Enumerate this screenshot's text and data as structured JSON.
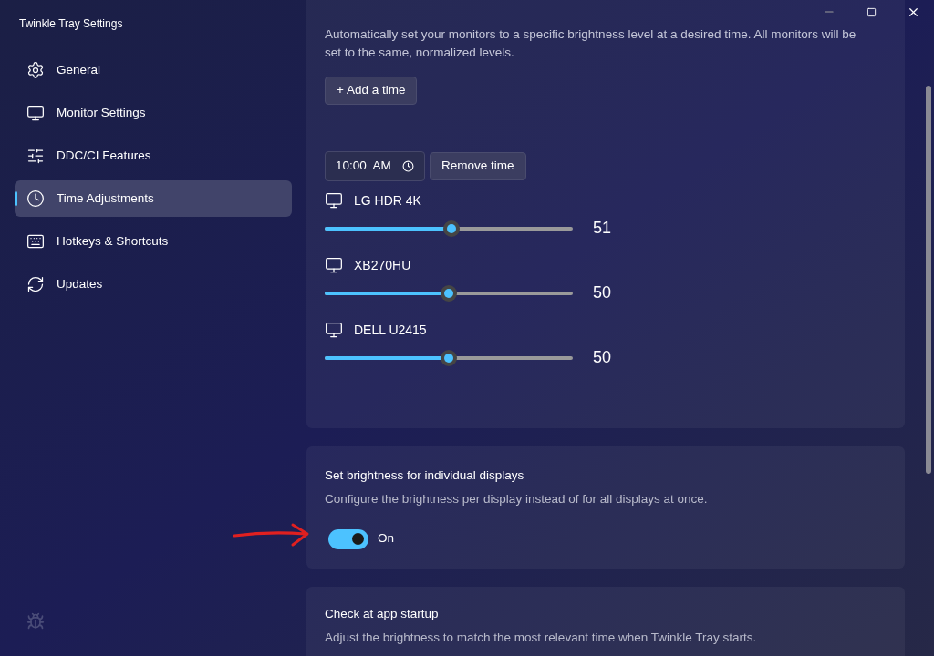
{
  "window": {
    "title": "Twinkle Tray Settings"
  },
  "sidebar": {
    "items": [
      {
        "label": "General",
        "selected": false
      },
      {
        "label": "Monitor Settings",
        "selected": false
      },
      {
        "label": "DDC/CI Features",
        "selected": false
      },
      {
        "label": "Time Adjustments",
        "selected": true
      },
      {
        "label": "Hotkeys & Shortcuts",
        "selected": false
      },
      {
        "label": "Updates",
        "selected": false
      }
    ]
  },
  "time_adjustments": {
    "description_line_1": "Automatically set your monitors to a specific brightness level at a desired time. All monitors will be",
    "description_line_2": "set to the same, normalized levels.",
    "add_button": "+ Add a time",
    "entry": {
      "time": "10:00  AM",
      "remove_button": "Remove time",
      "monitors": [
        {
          "name": "LG HDR 4K",
          "level": 0.51,
          "reading": "51"
        },
        {
          "name": "XB270HU",
          "level": 0.5,
          "reading": "50"
        },
        {
          "name": "DELL U2415",
          "level": 0.5,
          "reading": "50"
        }
      ]
    }
  },
  "individual_displays": {
    "title": "Set brightness for individual displays",
    "description": "Configure the brightness per display instead of for all displays at once.",
    "on": true,
    "state_label": "On"
  },
  "startup_check": {
    "title": "Check at app startup",
    "description": "Adjust the brightness to match the most relevant time when Twinkle Tray starts."
  }
}
